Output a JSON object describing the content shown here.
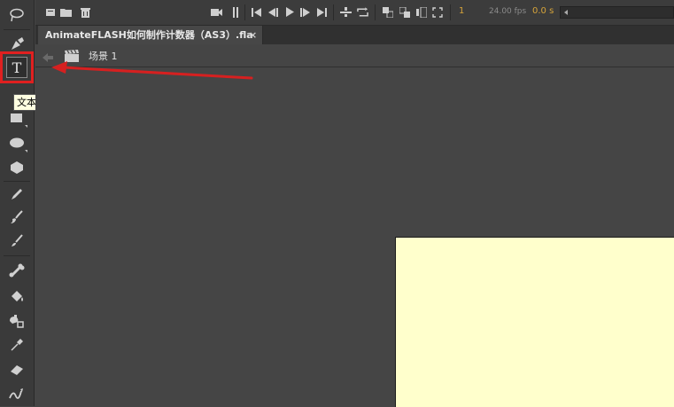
{
  "app": {
    "document_tab": {
      "title": "AnimateFLASH如何制作计数器（AS3）.fla",
      "close": "×"
    },
    "scene": {
      "label": "场景 1"
    }
  },
  "timeline_controls": {
    "current_frame": "1",
    "fps": "24.00 fps",
    "elapsed_time": "0.0 s"
  },
  "tools": {
    "selected_tool_tooltip": "文本工具 (T)",
    "text_tool_glyph": "T",
    "list": [
      "lasso-icon",
      "pen-icon",
      "text-icon",
      "line-icon",
      "rectangle-icon",
      "oval-icon",
      "polystar-icon",
      "pencil-icon",
      "paint-brush-icon",
      "brush-icon",
      "bone-icon",
      "paint-bucket-icon",
      "ink-bottle-icon",
      "eyedropper-icon",
      "eraser-icon",
      "width-tool-icon"
    ]
  },
  "colors": {
    "highlight": "#e02020",
    "stage_background": "#ffffcc",
    "workspace": "#454545",
    "accent_orange": "#d6a43a"
  }
}
